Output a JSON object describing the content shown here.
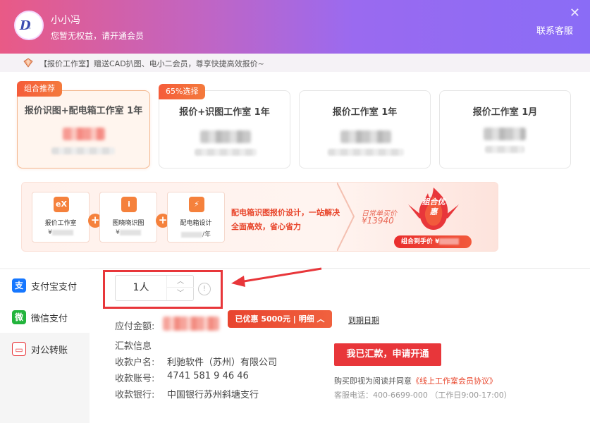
{
  "user": {
    "name": "小小冯",
    "status": "您暂无权益，请开通会员"
  },
  "header": {
    "service_label": "联系客服",
    "close_label": "✕"
  },
  "notice": {
    "text": "【报价工作室】赠送CAD扒图、电小二会员，尊享快捷高效报价~"
  },
  "plans": [
    {
      "title": "报价识图+配电箱工作室 1年",
      "tag": "组合推荐",
      "selected": true
    },
    {
      "title": "报价+识图工作室 1年",
      "tag": "65%选择",
      "selected": false
    },
    {
      "title": "报价工作室 1年",
      "tag": "",
      "selected": false
    },
    {
      "title": "报价工作室 1月",
      "tag": "",
      "selected": false
    }
  ],
  "combo": {
    "items": [
      {
        "icon_text": "eX",
        "name": "报价工作室",
        "price_prefix": "¥",
        "price_suffix": ""
      },
      {
        "icon_text": "i",
        "name": "图晓晓识图",
        "price_prefix": "¥",
        "price_suffix": ""
      },
      {
        "icon_text": "⚡",
        "name": "配电箱设计",
        "price_prefix": "",
        "price_suffix": "/年"
      }
    ],
    "plus": "+",
    "description": "配电箱识图报价设计，一站解决全面高效，省心省力",
    "daily_label": "日常单买价",
    "daily_price": "¥13940",
    "badge_text": "组合优惠",
    "combo_price_label": "组合到手价 ¥"
  },
  "payment": {
    "methods": [
      {
        "label": "支付宝支付",
        "icon": "alipay-icon",
        "color": "#1677ff",
        "glyph": "支"
      },
      {
        "label": "微信支付",
        "icon": "wechat-icon",
        "color": "#22b43c",
        "glyph": "微"
      },
      {
        "label": "对公转账",
        "icon": "bank-transfer-icon",
        "color": "#e8363a",
        "glyph": "▭"
      }
    ],
    "selected": "对公转账"
  },
  "quantity": {
    "value": "1人",
    "up": "︿",
    "down": "﹀",
    "info": "!"
  },
  "amount": {
    "label": "应付金额:",
    "discount_label": "已优惠 5000元 | 明细 ︿",
    "expire_link": "到期日期"
  },
  "remit": {
    "title": "汇款信息",
    "account_name_label": "收款户名:",
    "account_name": "利驰软件（苏州）有限公司",
    "account_no_label": "收款账号:",
    "account_no": "4741 581 9 46 46",
    "bank_label": "收款银行:",
    "bank": "中国银行苏州斜塘支行"
  },
  "actions": {
    "apply_label": "我已汇款，申请开通",
    "agree_prefix": "购买即视为阅读并同意",
    "agree_link": "《线上工作室会员协议》",
    "hotline": "客服电话：400-6699-000 （工作日9:00-17:00）"
  },
  "colors": {
    "accent": "#e8363a",
    "orange": "#f5813c",
    "header_start": "#e95a86",
    "header_end": "#8a6cf6"
  }
}
